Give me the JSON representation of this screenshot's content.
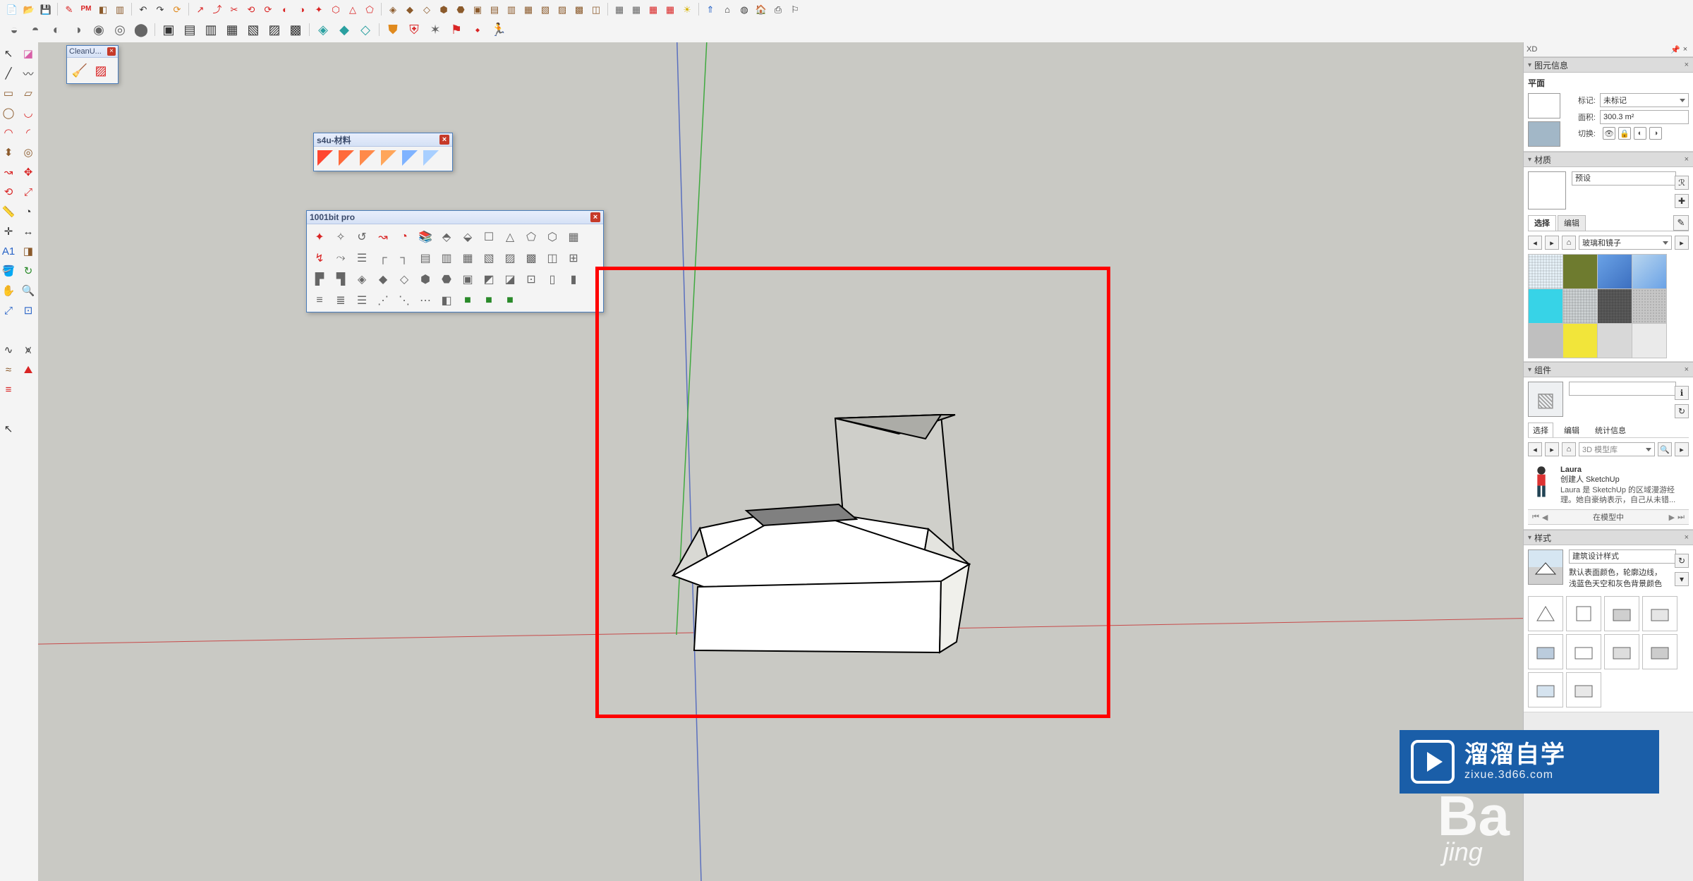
{
  "toolbar_row1": [
    {
      "name": "new-file-icon",
      "glyph": "📄",
      "cls": "c-gray"
    },
    {
      "name": "open-file-icon",
      "glyph": "📂",
      "cls": "c-gray"
    },
    {
      "name": "save-icon",
      "glyph": "💾",
      "cls": "c-blue"
    },
    {
      "sep": true
    },
    {
      "name": "pencil-icon",
      "glyph": "✎",
      "cls": "c-red"
    },
    {
      "name": "pm-icon",
      "glyph": "PM",
      "cls": "c-redtxt"
    },
    {
      "name": "cube-icon",
      "glyph": "◧",
      "cls": "c-brown"
    },
    {
      "name": "box-icon",
      "glyph": "▥",
      "cls": "c-brown"
    },
    {
      "sep": true
    },
    {
      "name": "undo-icon",
      "glyph": "↶",
      "cls": "c-dark"
    },
    {
      "name": "redo-icon",
      "glyph": "↷",
      "cls": "c-dark"
    },
    {
      "name": "refresh-icon",
      "glyph": "⟳",
      "cls": "c-orange"
    },
    {
      "sep": true
    },
    {
      "name": "tool-a-icon",
      "glyph": "↗",
      "cls": "c-red"
    },
    {
      "name": "tool-b-icon",
      "glyph": "⤴",
      "cls": "c-red"
    },
    {
      "name": "tool-c-icon",
      "glyph": "✂",
      "cls": "c-red"
    },
    {
      "name": "tool-d-icon",
      "glyph": "⟲",
      "cls": "c-red"
    },
    {
      "name": "tool-e-icon",
      "glyph": "⟳",
      "cls": "c-red"
    },
    {
      "name": "tool-f-icon",
      "glyph": "◐",
      "cls": "c-red"
    },
    {
      "name": "tool-g-icon",
      "glyph": "◑",
      "cls": "c-red"
    },
    {
      "name": "tool-h-icon",
      "glyph": "✦",
      "cls": "c-red"
    },
    {
      "name": "tool-i-icon",
      "glyph": "⬡",
      "cls": "c-red"
    },
    {
      "name": "tool-j-icon",
      "glyph": "△",
      "cls": "c-red"
    },
    {
      "name": "tool-k-icon",
      "glyph": "⬠",
      "cls": "c-red"
    },
    {
      "sep": true
    },
    {
      "name": "poly-a-icon",
      "glyph": "◈",
      "cls": "c-brown"
    },
    {
      "name": "poly-b-icon",
      "glyph": "◆",
      "cls": "c-brown"
    },
    {
      "name": "poly-c-icon",
      "glyph": "◇",
      "cls": "c-brown"
    },
    {
      "name": "poly-d-icon",
      "glyph": "⬢",
      "cls": "c-brown"
    },
    {
      "name": "poly-e-icon",
      "glyph": "⬣",
      "cls": "c-brown"
    },
    {
      "name": "poly-f-icon",
      "glyph": "▣",
      "cls": "c-brown"
    },
    {
      "name": "poly-g-icon",
      "glyph": "▤",
      "cls": "c-brown"
    },
    {
      "name": "poly-h-icon",
      "glyph": "▥",
      "cls": "c-brown"
    },
    {
      "name": "poly-i-icon",
      "glyph": "▦",
      "cls": "c-brown"
    },
    {
      "name": "poly-j-icon",
      "glyph": "▧",
      "cls": "c-brown"
    },
    {
      "name": "poly-k-icon",
      "glyph": "▨",
      "cls": "c-brown"
    },
    {
      "name": "poly-l-icon",
      "glyph": "▩",
      "cls": "c-brown"
    },
    {
      "name": "poly-m-icon",
      "glyph": "◫",
      "cls": "c-brown"
    },
    {
      "sep": true
    },
    {
      "name": "grid-a-icon",
      "glyph": "▦",
      "cls": "c-gray"
    },
    {
      "name": "grid-b-icon",
      "glyph": "▦",
      "cls": "c-gray"
    },
    {
      "name": "grid-c-icon",
      "glyph": "▦",
      "cls": "c-red"
    },
    {
      "name": "grid-d-icon",
      "glyph": "▦",
      "cls": "c-red"
    },
    {
      "name": "sun-icon",
      "glyph": "☀",
      "cls": "c-yellow"
    },
    {
      "sep": true
    },
    {
      "name": "north-icon",
      "glyph": "⇑",
      "cls": "c-blue"
    },
    {
      "name": "house-icon",
      "glyph": "⌂",
      "cls": "c-dark"
    },
    {
      "name": "globe-icon",
      "glyph": "◍",
      "cls": "c-dark"
    },
    {
      "name": "home-icon",
      "glyph": "🏠",
      "cls": "c-dark"
    },
    {
      "name": "print-icon",
      "glyph": "⎙",
      "cls": "c-dark"
    },
    {
      "name": "flag-icon",
      "glyph": "⚐",
      "cls": "c-dark"
    }
  ],
  "toolbar_row2": [
    {
      "name": "vray-a-icon",
      "glyph": "◒",
      "cls": "c-gray"
    },
    {
      "name": "vray-b-icon",
      "glyph": "◓",
      "cls": "c-gray"
    },
    {
      "name": "vray-c-icon",
      "glyph": "◐",
      "cls": "c-gray"
    },
    {
      "name": "vray-d-icon",
      "glyph": "◑",
      "cls": "c-gray"
    },
    {
      "name": "vray-e-icon",
      "glyph": "◉",
      "cls": "c-gray"
    },
    {
      "name": "vray-f-icon",
      "glyph": "◎",
      "cls": "c-gray"
    },
    {
      "name": "vray-g-icon",
      "glyph": "⬤",
      "cls": "c-gray"
    },
    {
      "sep": true
    },
    {
      "name": "box1-icon",
      "glyph": "▣",
      "cls": "c-dark"
    },
    {
      "name": "box2-icon",
      "glyph": "▤",
      "cls": "c-dark"
    },
    {
      "name": "box3-icon",
      "glyph": "▥",
      "cls": "c-dark"
    },
    {
      "name": "box4-icon",
      "glyph": "▦",
      "cls": "c-dark"
    },
    {
      "name": "box5-icon",
      "glyph": "▧",
      "cls": "c-dark"
    },
    {
      "name": "box6-icon",
      "glyph": "▨",
      "cls": "c-dark"
    },
    {
      "name": "box7-icon",
      "glyph": "▩",
      "cls": "c-dark"
    },
    {
      "sep": true
    },
    {
      "name": "gem1-icon",
      "glyph": "◈",
      "cls": "c-teal"
    },
    {
      "name": "gem2-icon",
      "glyph": "◆",
      "cls": "c-teal"
    },
    {
      "name": "gem3-icon",
      "glyph": "◇",
      "cls": "c-teal"
    },
    {
      "sep": true
    },
    {
      "name": "shield1-icon",
      "glyph": "⛊",
      "cls": "c-orange"
    },
    {
      "name": "shield2-icon",
      "glyph": "⛨",
      "cls": "c-red"
    },
    {
      "name": "star-icon",
      "glyph": "✶",
      "cls": "c-gray"
    },
    {
      "name": "flag2-icon",
      "glyph": "⚑",
      "cls": "c-red"
    },
    {
      "name": "led-icon",
      "glyph": "⬩",
      "cls": "c-red"
    },
    {
      "name": "run-icon",
      "glyph": "🏃",
      "cls": "c-red"
    }
  ],
  "left_tools": [
    {
      "name": "arrow-select-icon",
      "glyph": "↖",
      "cls": "c-dark"
    },
    {
      "name": "eraser-icon",
      "glyph": "◪",
      "cls": "c-pink"
    },
    {
      "name": "line-icon",
      "glyph": "╱",
      "cls": "c-dark"
    },
    {
      "name": "freehand-icon",
      "glyph": "〰",
      "cls": "c-dark"
    },
    {
      "name": "rect-icon",
      "glyph": "▭",
      "cls": "c-brown"
    },
    {
      "name": "rotrect-icon",
      "glyph": "▱",
      "cls": "c-brown"
    },
    {
      "name": "circle-icon",
      "glyph": "◯",
      "cls": "c-brown"
    },
    {
      "name": "arc-icon",
      "glyph": "◡",
      "cls": "c-red"
    },
    {
      "name": "arc2-icon",
      "glyph": "◠",
      "cls": "c-red"
    },
    {
      "name": "arc3-icon",
      "glyph": "◜",
      "cls": "c-red"
    },
    {
      "name": "push-pull-icon",
      "glyph": "⬍",
      "cls": "c-brown"
    },
    {
      "name": "offset-icon",
      "glyph": "◎",
      "cls": "c-brown"
    },
    {
      "name": "followme-icon",
      "glyph": "↝",
      "cls": "c-red"
    },
    {
      "name": "move-icon",
      "glyph": "✥",
      "cls": "c-red"
    },
    {
      "name": "rotate-icon",
      "glyph": "⟲",
      "cls": "c-red"
    },
    {
      "name": "scale-icon",
      "glyph": "⤢",
      "cls": "c-red"
    },
    {
      "name": "tape-icon",
      "glyph": "📏",
      "cls": "c-yellow"
    },
    {
      "name": "protractor-icon",
      "glyph": "◔",
      "cls": "c-dark"
    },
    {
      "name": "axes-icon",
      "glyph": "✛",
      "cls": "c-dark"
    },
    {
      "name": "dimension-icon",
      "glyph": "↔",
      "cls": "c-dark"
    },
    {
      "name": "text-icon",
      "glyph": "A1",
      "cls": "c-blue"
    },
    {
      "name": "sectionplane-icon",
      "glyph": "◨",
      "cls": "c-brown"
    },
    {
      "name": "paint-icon",
      "glyph": "🪣",
      "cls": "c-brown"
    },
    {
      "name": "orbit-icon",
      "glyph": "↻",
      "cls": "c-green"
    },
    {
      "name": "pan-icon",
      "glyph": "✋",
      "cls": "c-brown"
    },
    {
      "name": "zoom-icon",
      "glyph": "🔍",
      "cls": "c-blue"
    },
    {
      "name": "zoomext-icon",
      "glyph": "⤢",
      "cls": "c-blue"
    },
    {
      "name": "zoomwin-icon",
      "glyph": "⊡",
      "cls": "c-blue"
    }
  ],
  "left_tools2": [
    {
      "name": "curve-icon",
      "glyph": "∿",
      "cls": "c-dark"
    },
    {
      "name": "fur-icon",
      "glyph": "⩙",
      "cls": "c-dark"
    },
    {
      "name": "weld-icon",
      "glyph": "≈",
      "cls": "c-brown"
    },
    {
      "name": "roof-icon",
      "glyph": "⛰",
      "cls": "c-red"
    },
    {
      "name": "fence-icon",
      "glyph": "≡",
      "cls": "c-red"
    }
  ],
  "left_single": {
    "name": "select-arrow-icon",
    "glyph": "↖",
    "cls": "c-dark"
  },
  "cleanup": {
    "title": "CleanU...",
    "btns": [
      {
        "name": "cleanup-broom-icon",
        "glyph": "🧹",
        "cls": "c-blue"
      },
      {
        "name": "cleanup-erase-icon",
        "glyph": "▨",
        "cls": "c-red"
      }
    ]
  },
  "s4u_panel": {
    "title": "s4u-材料",
    "rows": [
      [
        {
          "name": "s4u-all-icon",
          "color": "#ff4630"
        },
        {
          "name": "s4u-front-icon",
          "color": "#ff6a3a"
        },
        {
          "name": "s4u-back-icon",
          "color": "#ff8a4a"
        },
        {
          "name": "s4u-line-icon",
          "color": "#ffa65a"
        },
        {
          "name": "s4u-ext-icon",
          "color": "#7fb3ff"
        },
        {
          "name": "s4u-remove-icon",
          "color": "#a8cfff"
        }
      ]
    ]
  },
  "bit_panel": {
    "title": "1001bit pro",
    "rows": [
      [
        {
          "name": "bit-r1c1",
          "glyph": "✦",
          "cls": "c-red"
        },
        {
          "name": "bit-r1c2",
          "glyph": "✧",
          "cls": "c-gray"
        },
        {
          "name": "bit-r1c3",
          "glyph": "↺",
          "cls": "c-gray"
        },
        {
          "name": "bit-r1c4",
          "glyph": "↝",
          "cls": "c-red"
        },
        {
          "name": "bit-r1c5",
          "glyph": "◔",
          "cls": "c-red"
        },
        {
          "name": "bit-r1c6",
          "glyph": "📚",
          "cls": "c-brown"
        },
        {
          "name": "bit-r1c7",
          "glyph": "⬘",
          "cls": "c-gray"
        },
        {
          "name": "bit-r1c8",
          "glyph": "⬙",
          "cls": "c-gray"
        },
        {
          "name": "bit-r1c9",
          "glyph": "☐",
          "cls": "c-gray"
        },
        {
          "name": "bit-r1c10",
          "glyph": "△",
          "cls": "c-gray"
        },
        {
          "name": "bit-r1c11",
          "glyph": "⬠",
          "cls": "c-gray"
        },
        {
          "name": "bit-r1c12",
          "glyph": "⬡",
          "cls": "c-gray"
        },
        {
          "name": "bit-r1c13",
          "glyph": "▦",
          "cls": "c-gray"
        }
      ],
      [
        {
          "name": "bit-r2c1",
          "glyph": "↯",
          "cls": "c-red"
        },
        {
          "name": "bit-r2c2",
          "glyph": "⤳",
          "cls": "c-gray"
        },
        {
          "name": "bit-r2c3",
          "glyph": "☰",
          "cls": "c-gray"
        },
        {
          "name": "bit-r2c4",
          "glyph": "┌",
          "cls": "c-gray"
        },
        {
          "name": "bit-r2c5",
          "glyph": "┐",
          "cls": "c-gray"
        },
        {
          "name": "bit-r2c6",
          "glyph": "▤",
          "cls": "c-gray"
        },
        {
          "name": "bit-r2c7",
          "glyph": "▥",
          "cls": "c-gray"
        },
        {
          "name": "bit-r2c8",
          "glyph": "▦",
          "cls": "c-gray"
        },
        {
          "name": "bit-r2c9",
          "glyph": "▧",
          "cls": "c-gray"
        },
        {
          "name": "bit-r2c10",
          "glyph": "▨",
          "cls": "c-gray"
        },
        {
          "name": "bit-r2c11",
          "glyph": "▩",
          "cls": "c-gray"
        },
        {
          "name": "bit-r2c12",
          "glyph": "◫",
          "cls": "c-gray"
        },
        {
          "name": "bit-r2c13",
          "glyph": "⊞",
          "cls": "c-gray"
        }
      ],
      [
        {
          "name": "bit-r3c1",
          "glyph": "▛",
          "cls": "c-gray"
        },
        {
          "name": "bit-r3c2",
          "glyph": "▜",
          "cls": "c-gray"
        },
        {
          "name": "bit-r3c3",
          "glyph": "◈",
          "cls": "c-gray"
        },
        {
          "name": "bit-r3c4",
          "glyph": "◆",
          "cls": "c-gray"
        },
        {
          "name": "bit-r3c5",
          "glyph": "◇",
          "cls": "c-gray"
        },
        {
          "name": "bit-r3c6",
          "glyph": "⬢",
          "cls": "c-gray"
        },
        {
          "name": "bit-r3c7",
          "glyph": "⬣",
          "cls": "c-gray"
        },
        {
          "name": "bit-r3c8",
          "glyph": "▣",
          "cls": "c-gray"
        },
        {
          "name": "bit-r3c9",
          "glyph": "◩",
          "cls": "c-gray"
        },
        {
          "name": "bit-r3c10",
          "glyph": "◪",
          "cls": "c-gray"
        },
        {
          "name": "bit-r3c11",
          "glyph": "⊡",
          "cls": "c-gray"
        },
        {
          "name": "bit-r3c12",
          "glyph": "▯",
          "cls": "c-gray"
        },
        {
          "name": "bit-r3c13",
          "glyph": "▮",
          "cls": "c-gray"
        }
      ],
      [
        {
          "name": "bit-r4c1",
          "glyph": "≡",
          "cls": "c-gray"
        },
        {
          "name": "bit-r4c2",
          "glyph": "≣",
          "cls": "c-gray"
        },
        {
          "name": "bit-r4c3",
          "glyph": "☰",
          "cls": "c-gray"
        },
        {
          "name": "bit-r4c4",
          "glyph": "⋰",
          "cls": "c-gray"
        },
        {
          "name": "bit-r4c5",
          "glyph": "⋱",
          "cls": "c-gray"
        },
        {
          "name": "bit-r4c6",
          "glyph": "⋯",
          "cls": "c-gray"
        },
        {
          "name": "bit-r4c7",
          "glyph": "◧",
          "cls": "c-gray"
        },
        {
          "name": "bit-r4c8",
          "glyph": "■",
          "cls": "c-green"
        },
        {
          "name": "bit-r4c9",
          "glyph": "■",
          "cls": "c-green"
        },
        {
          "name": "bit-r4c10",
          "glyph": "■",
          "cls": "c-green"
        }
      ]
    ]
  },
  "right": {
    "tray_label": "XD",
    "entity_info": {
      "title": "图元信息",
      "subtitle": "平面",
      "tag_label": "标记:",
      "tag_value": "未标记",
      "area_label": "面积:",
      "area_value": "300.3 m²",
      "toggle_label": "切换:"
    },
    "materials": {
      "title": "材质",
      "default_label": "预设",
      "select_tab": "选择",
      "edit_tab": "编辑",
      "collection": "玻璃和镜子",
      "swatches": [
        {
          "name": "mat-clear-glass",
          "bg": "#e9f4fb",
          "pat": "pattern"
        },
        {
          "name": "mat-olive",
          "bg": "#6e7b2f"
        },
        {
          "name": "mat-blue-gradient",
          "bg": "linear-gradient(135deg,#6aa2e6,#3c6fc0)"
        },
        {
          "name": "mat-sky-reflect",
          "bg": "linear-gradient(135deg,#b9d6ef,#6aa2e6)"
        },
        {
          "name": "mat-cyan",
          "bg": "#37d3e7"
        },
        {
          "name": "mat-stripes",
          "bg": "#cfd4d6",
          "pat": "pattern"
        },
        {
          "name": "mat-dark-grid",
          "bg": "#5b5b5b",
          "pat": "pattern"
        },
        {
          "name": "mat-noise",
          "bg": "#c6c6c6",
          "pat": "noise"
        },
        {
          "name": "mat-gray",
          "bg": "#bfbfbf"
        },
        {
          "name": "mat-yellow",
          "bg": "#f2e53a"
        },
        {
          "name": "mat-silver",
          "bg": "#d8d8d8"
        },
        {
          "name": "mat-light",
          "bg": "#eaeaea"
        }
      ]
    },
    "components": {
      "title": "组件",
      "select_tab": "选择",
      "edit_tab": "编辑",
      "stats_tab": "统计信息",
      "search_placeholder": "3D 模型库",
      "list_name": "Laura",
      "list_author": "创建人 SketchUp",
      "list_desc": "Laura 是 SketchUp 的区域漫游经理。她自豪纳表示，自己从未错...",
      "in_model_label": "在模型中"
    },
    "styles": {
      "title": "样式",
      "name_value": "建筑设计样式",
      "desc": "默认表面颜色，轮廓边线，浅蓝色天空和灰色背景颜色"
    }
  },
  "watermark_blue": {
    "cn": "溜溜自学",
    "en": "zixue.3d66.com"
  },
  "watermark_baidu": {
    "big": "Ba",
    "small": "jing"
  }
}
